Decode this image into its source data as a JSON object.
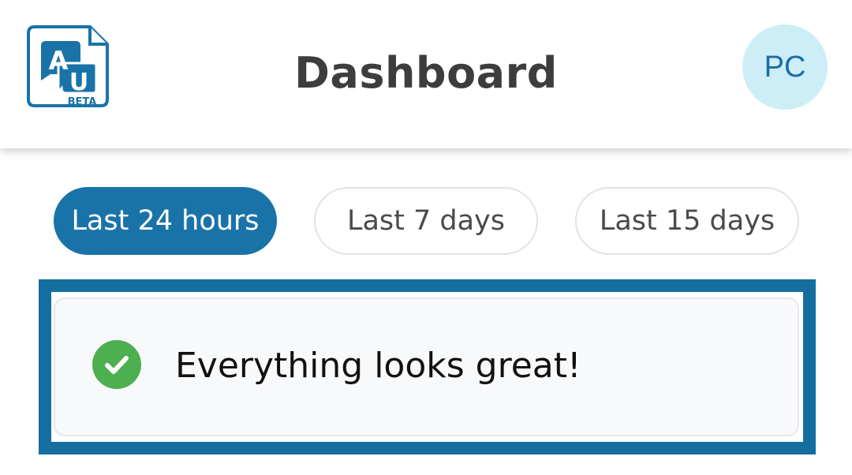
{
  "header": {
    "logo": {
      "letters_top": "A",
      "letters_bottom": "U",
      "badge": "BETA",
      "color": "#1a73a8"
    },
    "title": "Dashboard",
    "avatar_initials": "PC",
    "avatar_bg": "#cdeef6"
  },
  "filters": {
    "selected": "Last 24 hours",
    "options": [
      {
        "label": "Last 24 hours",
        "active": true
      },
      {
        "label": "Last 7 days",
        "active": false
      },
      {
        "label": "Last 15 days",
        "active": false
      }
    ]
  },
  "status": {
    "icon": "check-circle-icon",
    "icon_color": "#4caf50",
    "message": "Everything looks great!"
  },
  "colors": {
    "accent": "#1a73a8",
    "highlight_border": "#146fa0"
  }
}
